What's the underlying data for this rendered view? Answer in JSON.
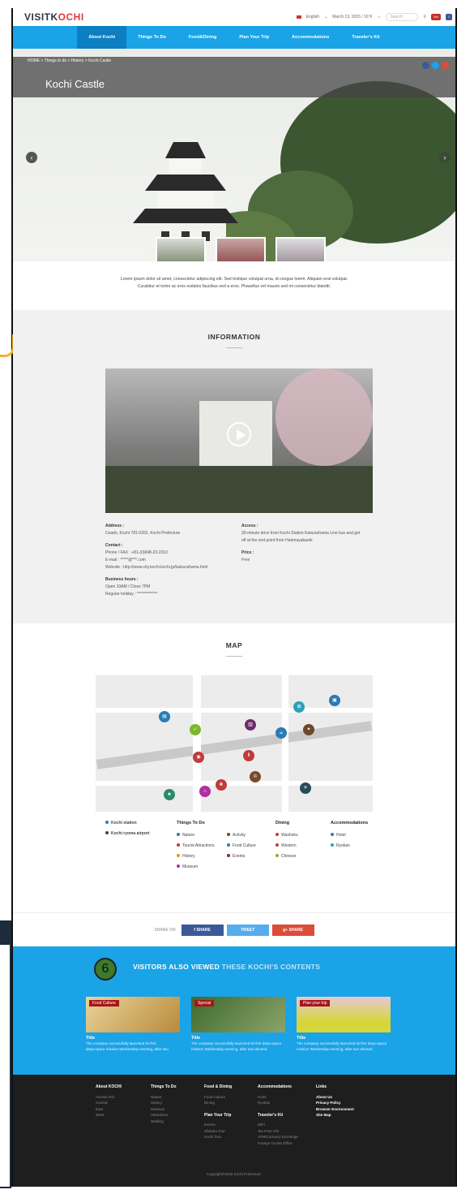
{
  "header": {
    "logo_main": "VISITK",
    "logo_accent": "OCHI",
    "language": "English",
    "date": "March 13, 2015 / 16°F",
    "search_placeholder": "Search"
  },
  "nav": [
    "About Kochi",
    "Things To Do",
    "Food&Dining",
    "Plan Your Trip",
    "Accommodations",
    "Traveler's Kit"
  ],
  "hero": {
    "breadcrumb": "HOME > Things to do > History > Kochi Castle",
    "title": "Kochi Castle",
    "caption_line1": "Lorem ipsum dolor sit amet, consectetur adipiscing elit. Sed tristique volutpat urna, id congue lorem. Aliquam erat volutpat.",
    "caption_line2": "Curabitur et tortor ac eros sodales faucibus sed a eros. Phasellus vel mauris sed mi consectetur blandit."
  },
  "information": {
    "title": "INFORMATION",
    "address_label": "Address :",
    "address": "Ceado, Kochi 781-0262, Kochi Prefecture",
    "contact_label": "Contact :",
    "phone": "Phone / FAX : +81-(0)848-23-2310",
    "email": "E-mail : *****@***.com",
    "website": "Website : http://www.city.kochi.kochi.jp/katsurahama.html",
    "hours_label": "Business hours :",
    "hours": "Open 10AM / Close 7PM",
    "holiday": "Regular holiday : *************",
    "access_label": "Access :",
    "access_line1": "30-minute drive from Kochi Station Katsurahama Line bus and get",
    "access_line2": "off at the end point from Harimayabashi",
    "price_label": "Price :",
    "price": "Free"
  },
  "map": {
    "title": "MAP",
    "stations": [
      "Kochi station",
      "Kochi ryoma airport"
    ],
    "things_title": "Things To Do",
    "things": [
      "Nature",
      "Activity",
      "Tourist Attractions",
      "Food Culture",
      "History",
      "Events",
      "Museum"
    ],
    "dining_title": "Dining",
    "dining": [
      "Washoku",
      "Western",
      "Chinese"
    ],
    "accommodations_title": "Accommodations",
    "accommodations": [
      "Hotel",
      "Ryokan"
    ]
  },
  "share": {
    "label": "SHARE ON",
    "facebook": "f  SHARE",
    "twitter": "TWEET",
    "google": "g+  SHARE"
  },
  "visitors": {
    "badge": "6",
    "title_bold": "VISITORS ALSO VIEWED",
    "title_light": "THESE KOCHI'S CONTENTS",
    "cards": [
      {
        "tag": "Food Culture",
        "title": "Title",
        "desc1": "The company successfully launched its first",
        "desc2": "deep-space mission Wednesday evening, after two"
      },
      {
        "tag": "Special",
        "title": "Title",
        "desc1": "The company successfully launched its first deep-space",
        "desc2": "mission Wednesday evening, after two aborted"
      },
      {
        "tag": "Plan your trip",
        "title": "Title",
        "desc1": "The company successfully launched its first deep-space",
        "desc2": "mission Wednesday evening, after two aborted"
      }
    ]
  },
  "footer": {
    "col1_title": "About KOCHI",
    "col1": [
      "Access Info",
      "Central",
      "East",
      "West"
    ],
    "col2_title": "Things To Do",
    "col2": [
      "Nature",
      "History",
      "Museum",
      "Attractions",
      "Walking"
    ],
    "col3_title": "Food & Dining",
    "col3": [
      "Food Culture",
      "Dining"
    ],
    "col3b_title": "Plan Your Trip",
    "col3b": [
      "Events",
      "Shikoku Tour",
      "Kochi Tour"
    ],
    "col4_title": "Accommodations",
    "col4": [
      "Hotel",
      "Ryokan"
    ],
    "col4b_title": "Traveler's Kit",
    "col4b": [
      "WiFi",
      "Tax Free Info",
      "ATM/Currency Exchange",
      "Foreign Tourist Office"
    ],
    "col5_title": "Links",
    "col5": [
      "About Us",
      "Privacy Policy",
      "Browser Environment",
      "Site Map"
    ],
    "copyright": "Copyright©2015 Kochi Prefecture."
  }
}
